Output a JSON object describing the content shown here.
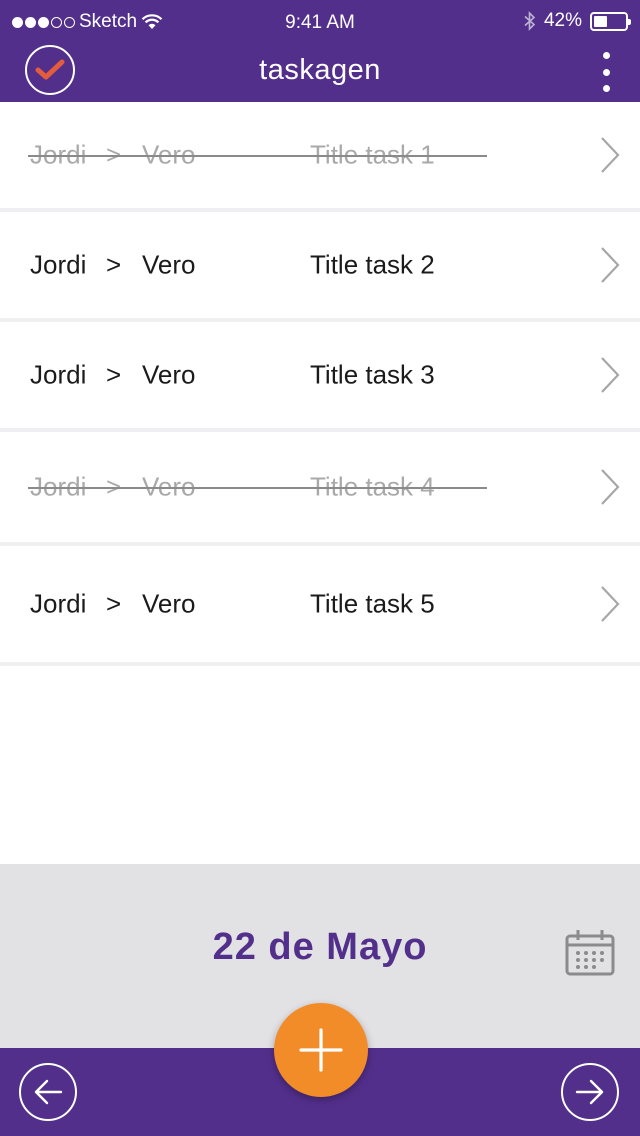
{
  "status_bar": {
    "carrier": "Sketch",
    "time": "9:41 AM",
    "battery": "42%",
    "battery_level": 0.42,
    "signal_bars": 3
  },
  "header": {
    "app_title": "taskagen",
    "accent_color": "#532f8c",
    "check_color": "#e35d3c"
  },
  "tasks": [
    {
      "from": "Jordi",
      "separator": ">",
      "to": "Vero",
      "title": "Title task 1",
      "completed": true
    },
    {
      "from": "Jordi",
      "separator": ">",
      "to": "Vero",
      "title": "Title task 2",
      "completed": false
    },
    {
      "from": "Jordi",
      "separator": ">",
      "to": "Vero",
      "title": "Title task 3",
      "completed": false
    },
    {
      "from": "Jordi",
      "separator": ">",
      "to": "Vero",
      "title": "Title task 4",
      "completed": true
    },
    {
      "from": "Jordi",
      "separator": ">",
      "to": "Vero",
      "title": "Title task 5",
      "completed": false
    }
  ],
  "date_bar": {
    "date": "22 de Mayo"
  },
  "fab": {
    "icon": "plus-icon",
    "color": "#f28c28"
  },
  "bottom_nav": {
    "prev_icon": "arrow-left-icon",
    "next_icon": "arrow-right-icon"
  }
}
